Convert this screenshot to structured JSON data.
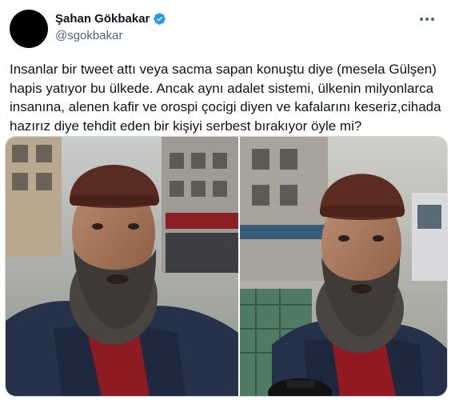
{
  "author": {
    "display_name": "Şahan Gökbakar",
    "handle": "@sgokbakar",
    "verified": true,
    "avatar_icon": "avatar-circle"
  },
  "tweet": {
    "text": "Insanlar bir tweet attı veya sacma sapan konuştu diye (mesela Gülşen) hapis yatıyor bu ülkede. Ancak aynı adalet sistemi, ülkenin milyonlarca insanına, alenen kafir ve orospi çocigi diyen ve kafalarını keseriz,cihada hazırız diye tehdit eden bir kişiyi serbest bırakıyor öyle mi?"
  },
  "media": {
    "photos": [
      {
        "icon": "man-photo-street-left"
      },
      {
        "icon": "man-photo-street-right"
      }
    ]
  },
  "colors": {
    "text": "#0f1419",
    "secondary": "#536471",
    "verified": "#1d9bf0",
    "border": "#cfd9de"
  },
  "icons": {
    "verified": "verified-badge-icon",
    "more": "more-dots-icon"
  }
}
